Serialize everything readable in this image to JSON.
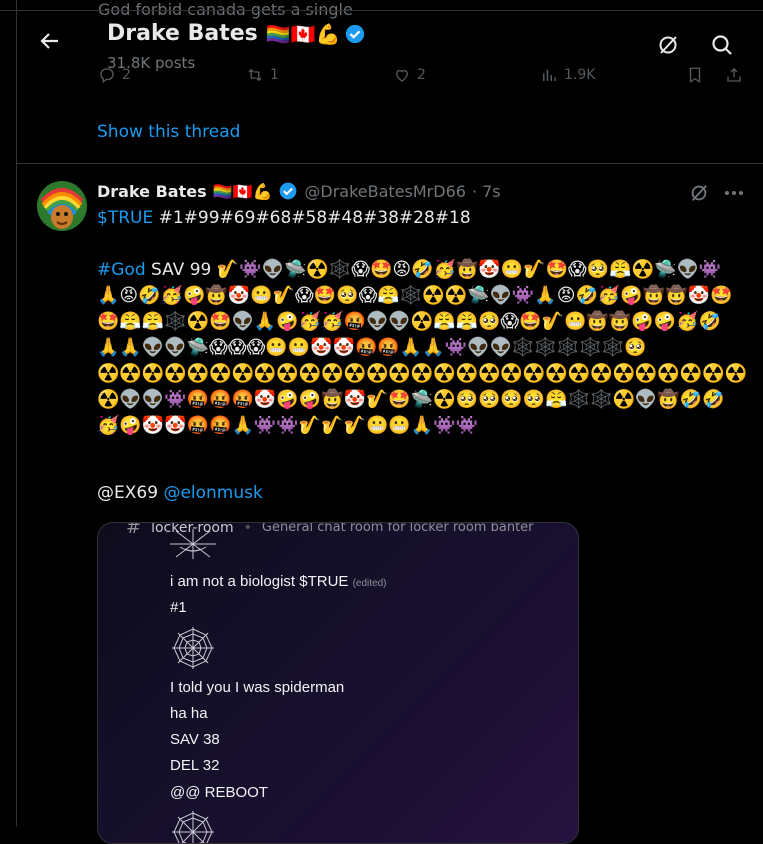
{
  "ghost": {
    "text": "God forbid canada gets a single",
    "replies": "2",
    "reposts": "1",
    "likes": "2",
    "views": "1.9K"
  },
  "header": {
    "name": "Drake Bates",
    "flags": "🏳️‍🌈🇨🇦💪",
    "posts": "31.8K posts"
  },
  "show_thread": "Show this thread",
  "tweet": {
    "name": "Drake Bates",
    "flags": "🏳️‍🌈🇨🇦💪",
    "handle": "@DrakeBatesMrD66",
    "time": "· 7s",
    "line1_tag": "$TRUE",
    "line1_rest": " #1#99#69#68#58#48#38#28#18",
    "god_tag": "#God",
    "god_rest": " SAV 99 ",
    "emojis": "🎷👾👽🛸☢️🕸️😱🤩😡🤣🥳🤠🤡😬🎷🤩😱🥺😤☢️🛸👽👾🙏😡🤣🥳🤪🤠🤡😬🎷😱🤩🥺😱😤🕸️☢️☢️🛸👽👾🙏😡🤣🥳🤪🤠🤠🤡🤩🤩😤😤🕸️☢️🤩👽🙏🤪🥳🥳🤬👽👽☢️😤😤🥺😱🤩🎷😬🤠🤠🤪🤪🥳🤣🙏🙏👽👽🛸😱😱😱😬😬🤡🤡🤬🤬🙏🙏👾👽👽🕸️🕸️🕸️🕸️🕸️🥺☢️☢️☢️☢️☢️☢️☢️☢️☢️☢️☢️☢️☢️☢️☢️☢️☢️☢️☢️☢️☢️☢️☢️☢️☢️☢️☢️☢️☢️☢️👽👽👾🤬🤬🤬🤡🤪🤪🤠🤡🎷🤩🛸☢️🥺🥺🥺🥺😤🕸️🕸️☢️👽🤠🤣🤣🥳🤪🤡🤡🤬🤬🙏👾👾🎷🎷🎷😬😬🙏👾👾",
    "mention1": "@EX69",
    "mention2": "@elonmusk"
  },
  "media": {
    "channel_name": "locker-room",
    "channel_topic": "General chat room for locker room banter",
    "msg1": "i am not a biologist $TRUE",
    "msg1_edited": "(edited)",
    "msg2": "#1",
    "msg3": "I told you I was spiderman",
    "msg4": "ha ha",
    "msg5": "SAV 38",
    "msg6": "DEL 32",
    "msg7": "@@ REBOOT"
  },
  "colors": {
    "accent": "#1d9bf0",
    "background": "#000000",
    "secondary_text": "#71767b",
    "verified": "#1d9bf0"
  }
}
